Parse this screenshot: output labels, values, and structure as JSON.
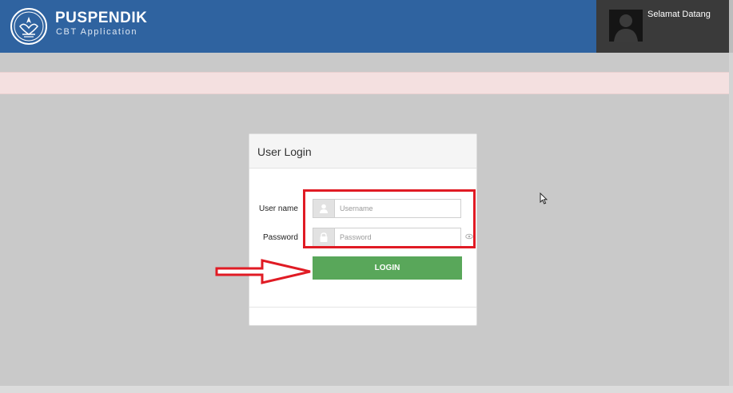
{
  "header": {
    "brand_title": "PUSPENDIK",
    "brand_subtitle": "CBT Application",
    "welcome_text": "Selamat Datang"
  },
  "login": {
    "title": "User Login",
    "username_label": "User name",
    "username_placeholder": "Username",
    "password_label": "Password",
    "password_placeholder": "Password",
    "button_label": "LOGIN"
  },
  "icons": {
    "logo": "tut-wuri-handayani-logo",
    "avatar": "user-silhouette-icon",
    "username": "user-icon",
    "password": "lock-icon",
    "reveal": "eye-icon",
    "cursor": "mouse-pointer-icon"
  },
  "colors": {
    "header": "#2f63a0",
    "user_box": "#3a3a3a",
    "background": "#c9c9c9",
    "alert": "#f4e0e0",
    "button": "#59a75a",
    "annotation": "#e01b24"
  }
}
